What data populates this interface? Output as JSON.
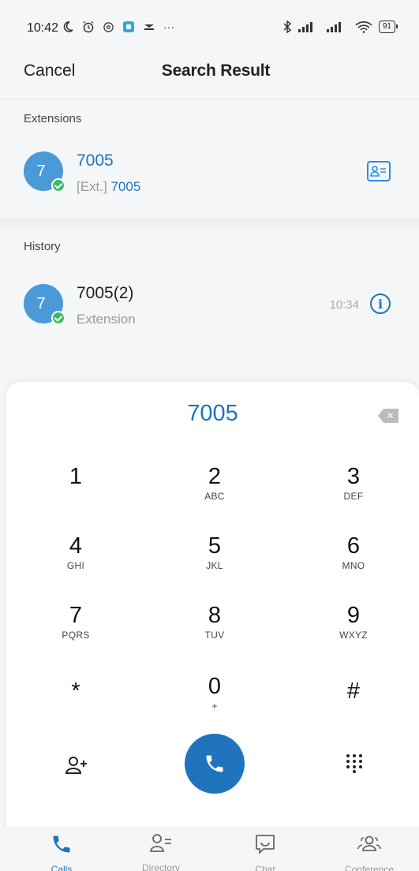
{
  "status_bar": {
    "time": "10:42",
    "battery": "91",
    "more": "···"
  },
  "header": {
    "cancel_label": "Cancel",
    "title": "Search Result"
  },
  "extensions": {
    "section_label": "Extensions",
    "item": {
      "avatar_initial": "7",
      "name": "7005",
      "ext_prefix": "[Ext.]",
      "ext_number": "7005"
    }
  },
  "history": {
    "section_label": "History",
    "item": {
      "avatar_initial": "7",
      "name": "7005(2)",
      "subtitle": "Extension",
      "time": "10:34"
    }
  },
  "dialpad": {
    "dialed_number": "7005",
    "keys": [
      {
        "digit": "1",
        "letters": ""
      },
      {
        "digit": "2",
        "letters": "ABC"
      },
      {
        "digit": "3",
        "letters": "DEF"
      },
      {
        "digit": "4",
        "letters": "GHI"
      },
      {
        "digit": "5",
        "letters": "JKL"
      },
      {
        "digit": "6",
        "letters": "MNO"
      },
      {
        "digit": "7",
        "letters": "PQRS"
      },
      {
        "digit": "8",
        "letters": "TUV"
      },
      {
        "digit": "9",
        "letters": "WXYZ"
      },
      {
        "digit": "*",
        "letters": ""
      },
      {
        "digit": "0",
        "letters": "+"
      },
      {
        "digit": "#",
        "letters": ""
      }
    ]
  },
  "bottom_nav": {
    "items": [
      {
        "label": "Calls",
        "icon": "phone-icon"
      },
      {
        "label": "Directory",
        "icon": "directory-icon"
      },
      {
        "label": "Chat",
        "icon": "chat-icon"
      },
      {
        "label": "Conference",
        "icon": "conference-icon"
      }
    ],
    "active": "Calls"
  },
  "colors": {
    "accent": "#1f74bd",
    "presence": "#3cba6a",
    "avatar": "#4a9ad8"
  }
}
